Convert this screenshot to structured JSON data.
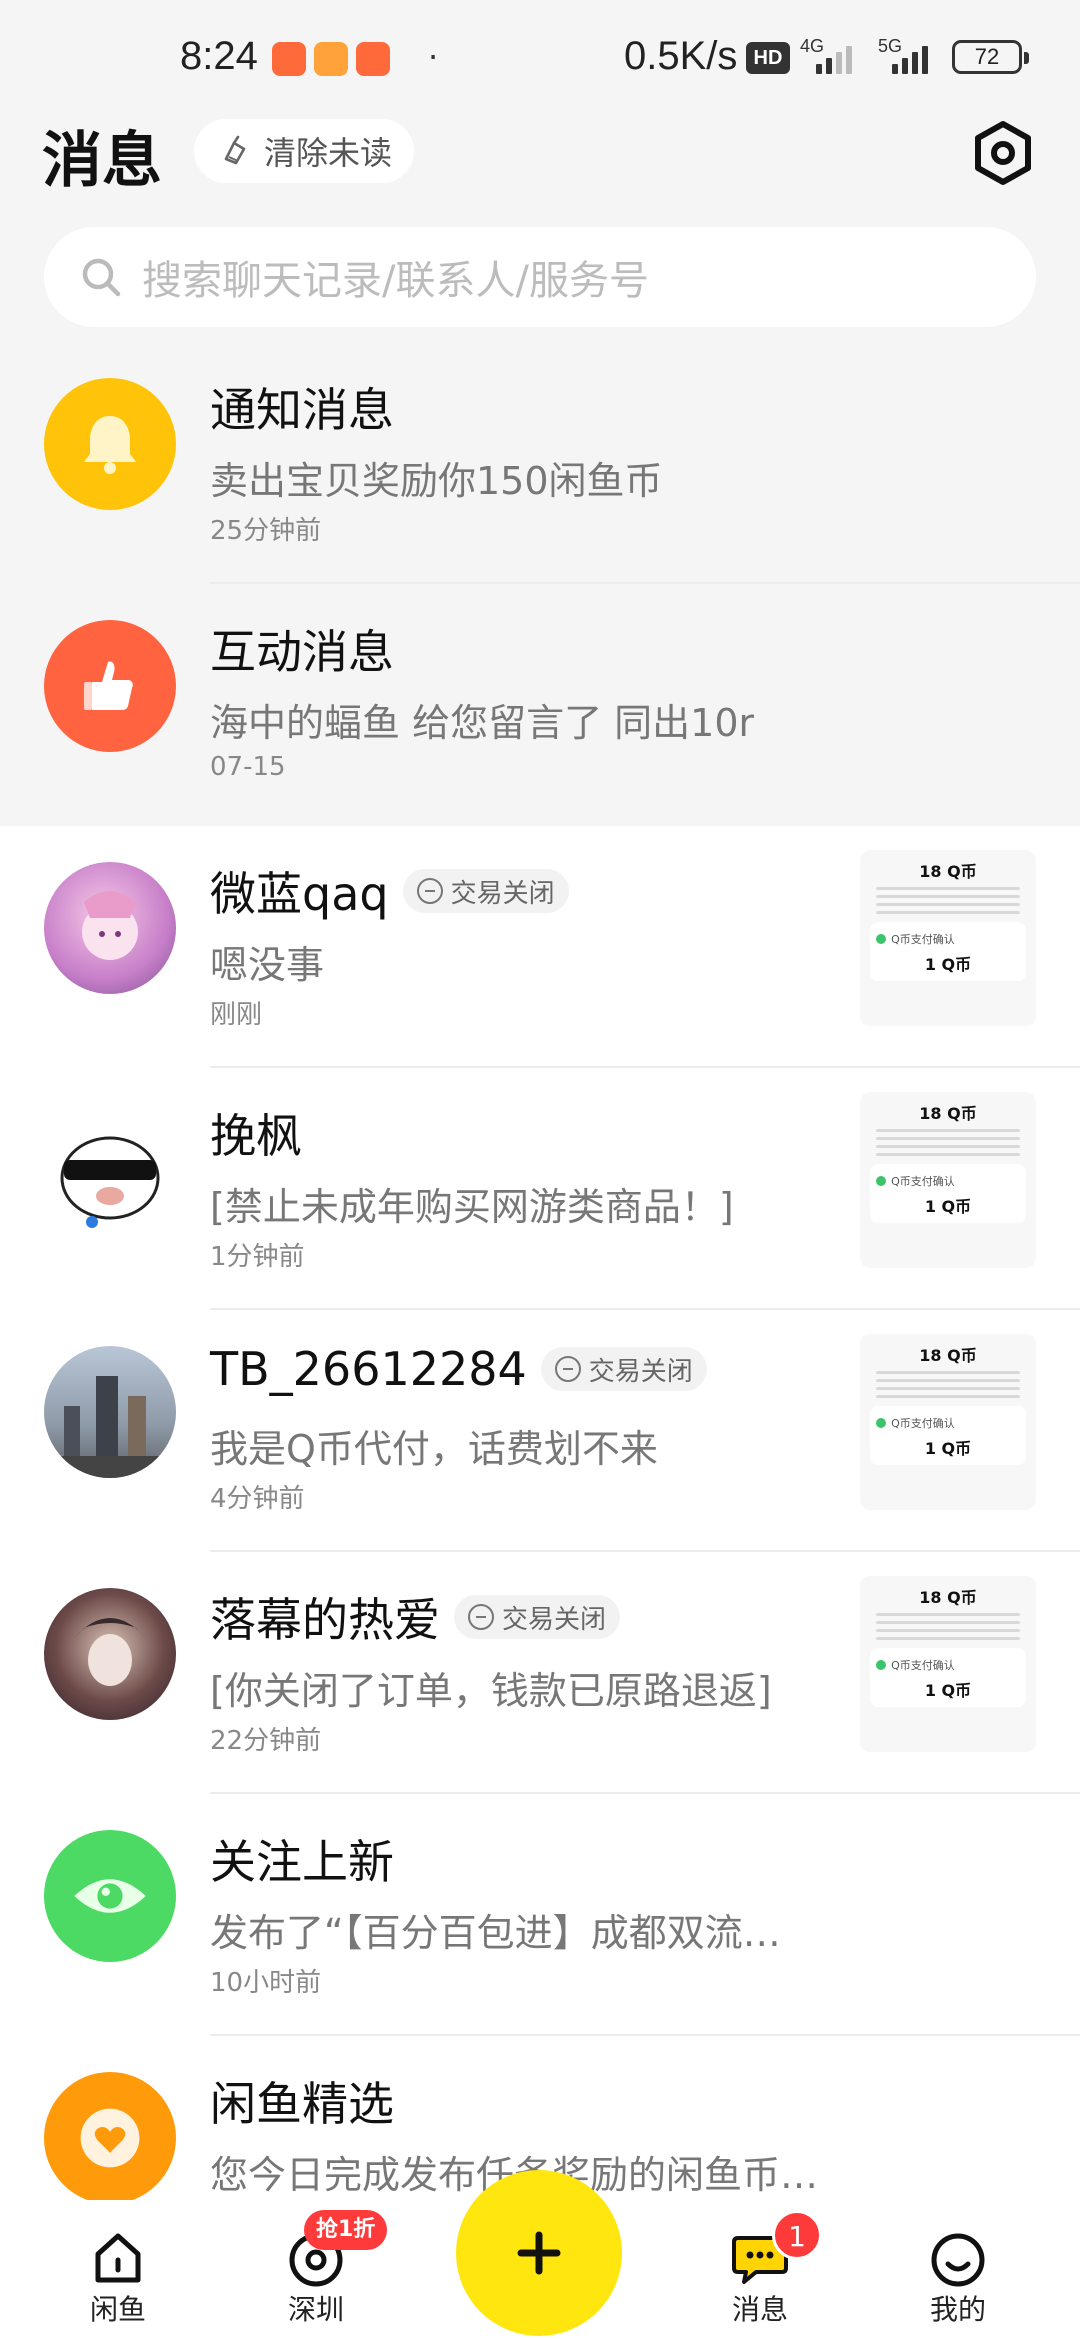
{
  "status_bar": {
    "time": "8:24",
    "dot": "·",
    "net_speed": "0.5K/s",
    "hd_badge": "HD",
    "net1": "4G",
    "net2": "5G",
    "battery": "72"
  },
  "header": {
    "title": "消息",
    "clear_unread": "清除未读",
    "search_placeholder": "搜索聊天记录/联系人/服务号"
  },
  "system_rows": [
    {
      "name": "通知消息",
      "preview": "卖出宝贝奖励你150闲鱼币",
      "time": "25分钟前",
      "icon": "bell-icon",
      "color": "#ffc40a"
    },
    {
      "name": "互动消息",
      "preview": "海中的蝠鱼 给您留言了 同出10r",
      "time": "07-15",
      "icon": "thumbs-up-icon",
      "color": "#ff6340"
    }
  ],
  "chat_rows": [
    {
      "name": "微蓝qaq",
      "tag": "交易关闭",
      "preview": "嗯没事",
      "time": "刚刚"
    },
    {
      "name": "挽枫",
      "tag": "",
      "preview": "[禁止未成年购买网游类商品！]",
      "time": "1分钟前"
    },
    {
      "name": "TB_26612284",
      "tag": "交易关闭",
      "preview": "我是Q币代付，话费划不来",
      "time": "4分钟前"
    },
    {
      "name": "落幕的热爱",
      "tag": "交易关闭",
      "preview": "[你关闭了订单，钱款已原路退返]",
      "time": "22分钟前"
    }
  ],
  "thumbnail": {
    "title": "18 Q币",
    "card_label": "Q币支付确认",
    "value": "1 Q币"
  },
  "bottom_rows": [
    {
      "name": "关注上新",
      "preview": "发布了“【百分百包进】成都双流…",
      "time": "10小时前",
      "icon": "eye-icon",
      "color": "#4cd964"
    },
    {
      "name": "闲鱼精选",
      "preview": "您今日完成发布任务奖励的闲鱼币…",
      "time": "",
      "icon": "heart-icon",
      "color": "#ff9a0a"
    }
  ],
  "tab_bar": {
    "tabs": [
      {
        "label": "闲鱼",
        "icon": "home-icon"
      },
      {
        "label": "深圳",
        "icon": "location-icon"
      },
      {
        "label": "消息",
        "icon": "chat-icon"
      },
      {
        "label": "我的",
        "icon": "profile-icon"
      }
    ],
    "promo_badge": "抢1折",
    "message_badge": "1",
    "post_icon": "plus-icon"
  },
  "colors": {
    "accent": "#ffe60f",
    "badge": "#ff3a3a"
  }
}
